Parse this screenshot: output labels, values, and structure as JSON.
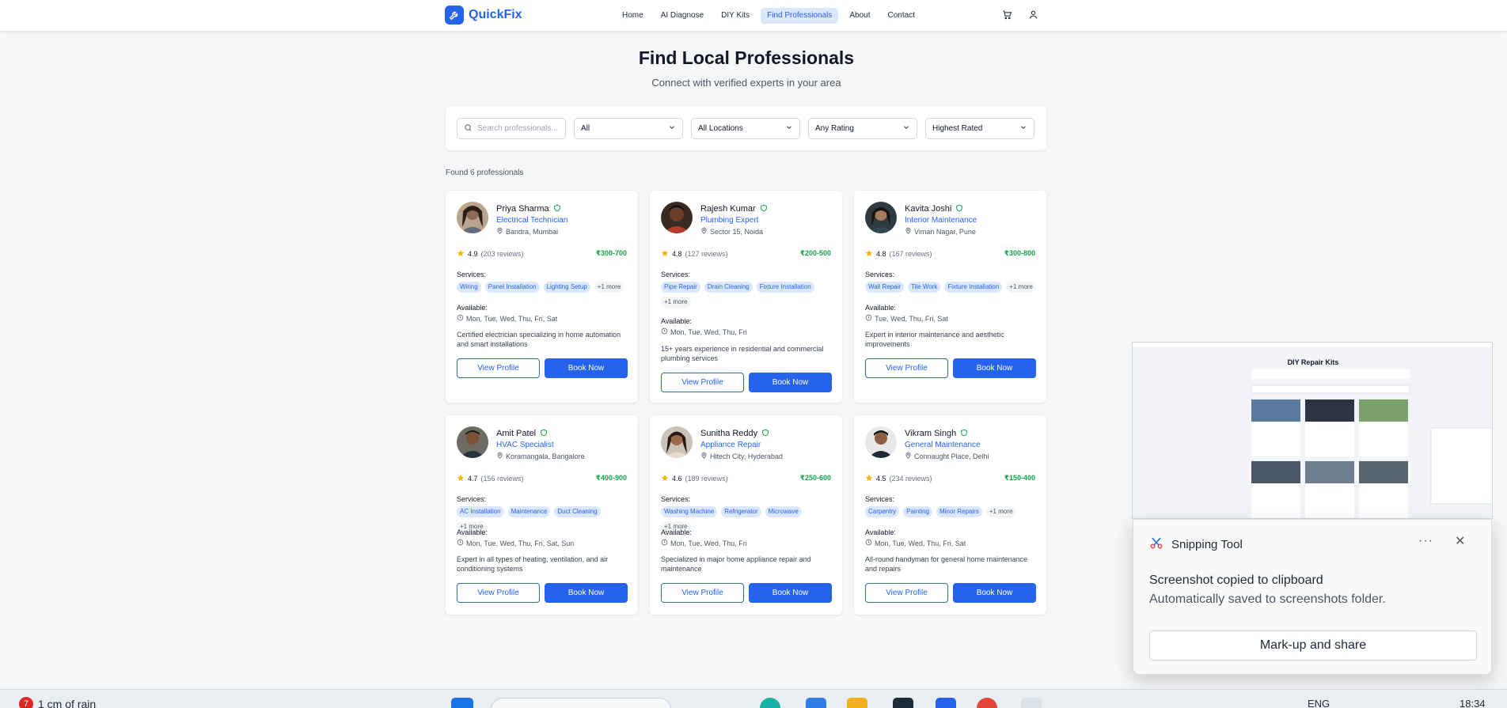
{
  "nav": {
    "brand": "QuickFix",
    "links": [
      "Home",
      "AI Diagnose",
      "DIY Kits",
      "Find Professionals",
      "About",
      "Contact"
    ],
    "active": "Find Professionals"
  },
  "header": {
    "title": "Find Local Professionals",
    "subtitle": "Connect with verified experts in your area"
  },
  "filters": {
    "search_placeholder": "Search professionals...",
    "category": "All",
    "location": "All Locations",
    "rating": "Any Rating",
    "sort": "Highest Rated"
  },
  "results_text": "Found 6 professionals",
  "labels": {
    "services": "Services:",
    "available": "Available:",
    "view_profile": "View Profile",
    "book_now": "Book Now"
  },
  "professionals": [
    {
      "name": "Priya Sharma",
      "role": "Electrical Technician",
      "location": "Bandra, Mumbai",
      "rating": "4.9",
      "reviews": "(203 reviews)",
      "price": "₹300-700",
      "services": [
        "Wiring",
        "Panel Installation",
        "Lighting Setup"
      ],
      "more": "+1 more",
      "availability": "Mon, Tue, Wed, Thu, Fri, Sat",
      "description": "Certified electrician specializing in home automation and smart installations"
    },
    {
      "name": "Rajesh Kumar",
      "role": "Plumbing Expert",
      "location": "Sector 15, Noida",
      "rating": "4.8",
      "reviews": "(127 reviews)",
      "price": "₹200-500",
      "services": [
        "Pipe Repair",
        "Drain Cleaning",
        "Fixture Installation"
      ],
      "more": "+1 more",
      "availability": "Mon, Tue, Wed, Thu, Fri",
      "description": "15+ years experience in residential and commercial plumbing services"
    },
    {
      "name": "Kavita Joshi",
      "role": "Interior Maintenance",
      "location": "Viman Nagar, Pune",
      "rating": "4.8",
      "reviews": "(167 reviews)",
      "price": "₹300-800",
      "services": [
        "Wall Repair",
        "Tile Work",
        "Fixture Installation"
      ],
      "more": "+1 more",
      "availability": "Tue, Wed, Thu, Fri, Sat",
      "description": "Expert in interior maintenance and aesthetic improvements"
    },
    {
      "name": "Amit Patel",
      "role": "HVAC Specialist",
      "location": "Koramangala, Bangalore",
      "rating": "4.7",
      "reviews": "(156 reviews)",
      "price": "₹400-900",
      "services": [
        "AC Installation",
        "Maintenance",
        "Duct Cleaning"
      ],
      "more": "+1 more",
      "availability": "Mon, Tue, Wed, Thu, Fri, Sat, Sun",
      "description": "Expert in all types of heating, ventilation, and air conditioning systems"
    },
    {
      "name": "Sunitha Reddy",
      "role": "Appliance Repair",
      "location": "Hitech City, Hyderabad",
      "rating": "4.6",
      "reviews": "(189 reviews)",
      "price": "₹250-600",
      "services": [
        "Washing Machine",
        "Refrigerator",
        "Microwave"
      ],
      "more": "+1 more",
      "availability": "Mon, Tue, Wed, Thu, Fri",
      "description": "Specialized in major home appliance repair and maintenance"
    },
    {
      "name": "Vikram Singh",
      "role": "General Maintenance",
      "location": "Connaught Place, Delhi",
      "rating": "4.5",
      "reviews": "(234 reviews)",
      "price": "₹150-400",
      "services": [
        "Carpentry",
        "Painting",
        "Minor Repairs"
      ],
      "more": "+1 more",
      "availability": "Mon, Tue, Wed, Thu, Fri, Sat",
      "description": "All-round handyman for general home maintenance and repairs"
    }
  ],
  "snipping_tool": {
    "app_name": "Snipping Tool",
    "more": "···",
    "close": "✕",
    "message": "Screenshot copied to clipboard",
    "detail": "Automatically saved to screenshots folder.",
    "action": "Mark-up and share",
    "thumbnail_title": "DIY Repair Kits"
  },
  "taskbar": {
    "weather_badge": "7",
    "weather": "1 cm of rain",
    "language": "ENG",
    "time": "18:34"
  },
  "colors": {
    "accent": "#2563eb",
    "price": "#16a34a",
    "tag_bg": "#dbe7fb",
    "star": "#f5b400"
  }
}
